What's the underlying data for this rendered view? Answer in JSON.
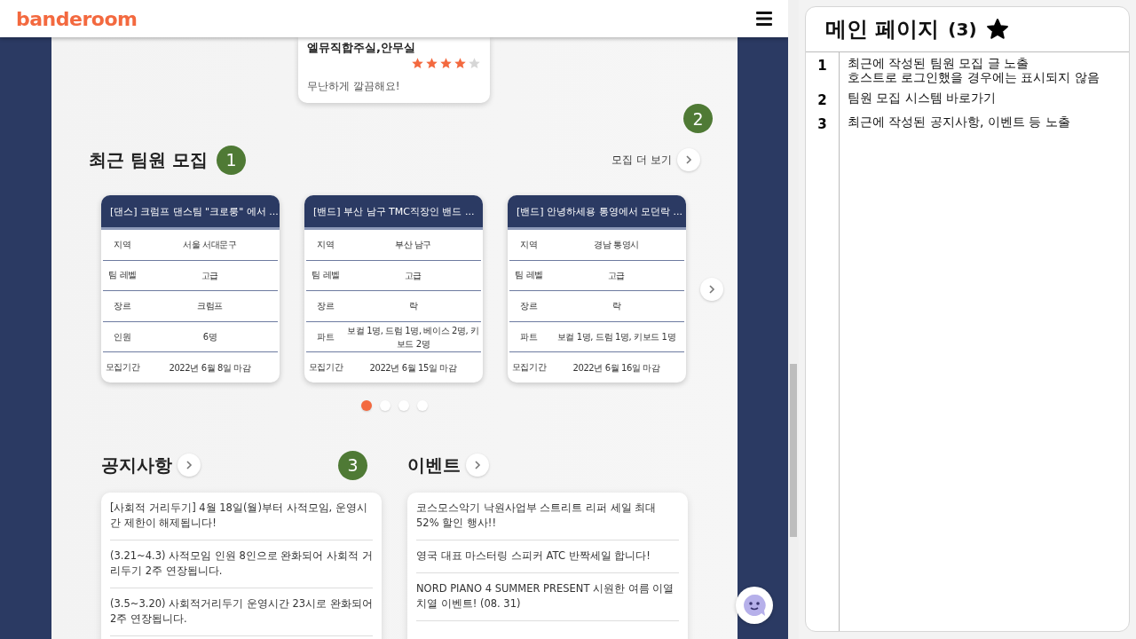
{
  "header": {
    "logo": "banderoom"
  },
  "review": {
    "title": "엘뮤직합주실,안무실",
    "stars": 4,
    "comment": "무난하게 깔끔해요!"
  },
  "recruit": {
    "title": "최근 팀원 모집",
    "badge": "1",
    "more_badge": "2",
    "more_link": "모집 더 보기",
    "cards": [
      {
        "title": "[댄스] 크럼프 댄스팀 \"크로룽\" 에서 ...",
        "rows": [
          {
            "label": "지역",
            "value": "서울 서대문구"
          },
          {
            "label": "팀 레벨",
            "value": "고급"
          },
          {
            "label": "장르",
            "value": "크럼프"
          },
          {
            "label": "인원",
            "value": "6명"
          },
          {
            "label": "모집기간",
            "value": "2022년 6월 8일 마감"
          }
        ]
      },
      {
        "title": "[밴드] 부산 남구 TMC직장인 밴드 ...",
        "rows": [
          {
            "label": "지역",
            "value": "부산 남구"
          },
          {
            "label": "팀 레벨",
            "value": "고급"
          },
          {
            "label": "장르",
            "value": "락"
          },
          {
            "label": "파트",
            "value": "보컬 1명, 드럼 1명, 베이스 2명, 키보드 2명"
          },
          {
            "label": "모집기간",
            "value": "2022년 6월 15일 마감"
          }
        ]
      },
      {
        "title": "[밴드] 안녕하세용 통영에서 모던락 ...",
        "rows": [
          {
            "label": "지역",
            "value": "경남 통영시"
          },
          {
            "label": "팀 레벨",
            "value": "고급"
          },
          {
            "label": "장르",
            "value": "락"
          },
          {
            "label": "파트",
            "value": "보컬 1명, 드럼 1명, 키보드 1명"
          },
          {
            "label": "모집기간",
            "value": "2022년 6월 16일 마감"
          }
        ]
      }
    ],
    "pager": [
      {
        "selected": true
      },
      {
        "selected": false
      },
      {
        "selected": false
      },
      {
        "selected": false
      }
    ]
  },
  "notices": {
    "title": "공지사항",
    "badge": "3",
    "items": [
      "[사회적 거리두기] 4월 18일(월)부터 사적모임, 운영시간 제한이 해제됩니다!",
      "(3.21~4.3) 사적모임 인원 8인으로 완화되어 사회적 거리두기 2주 연장됩니다.",
      "(3.5~3.20) 사회적거리두기 운영시간 23시로 완화되어 2주 연장됩니다."
    ]
  },
  "events": {
    "title": "이벤트",
    "items": [
      "코스모스악기 낙원사업부 스트리트 리퍼 세일 최대 52% 할인 행사!!",
      "영국 대표 마스터링 스피커 ATC 반짝세일 합니다!",
      "NORD PIANO 4 SUMMER PRESENT 시원한 여름 이열치열 이벤트! (08. 31)"
    ]
  },
  "panel": {
    "title": "메인 페이지",
    "count": "(3)",
    "notes": [
      {
        "number": "1",
        "text": "최근에 작성된 팀원 모집 글 노출\n호스트로 로그인했을 경우에는 표시되지 않음"
      },
      {
        "number": "2",
        "text": "팀원 모집 시스템 바로가기"
      },
      {
        "number": "3",
        "text": "최근에 작성된 공지사항, 이벤트 등 노출"
      }
    ]
  }
}
